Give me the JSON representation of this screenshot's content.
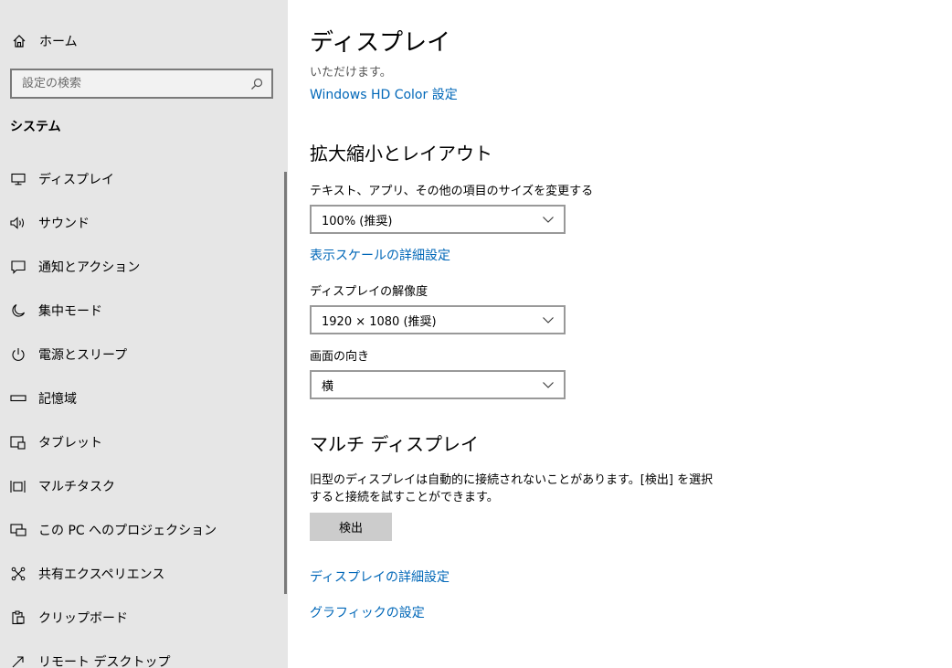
{
  "sidebar": {
    "home_label": "ホーム",
    "search_placeholder": "設定の検索",
    "section_label": "システム",
    "items": [
      {
        "label": "ディスプレイ",
        "icon": "monitor-icon"
      },
      {
        "label": "サウンド",
        "icon": "speaker-icon"
      },
      {
        "label": "通知とアクション",
        "icon": "message-icon"
      },
      {
        "label": "集中モード",
        "icon": "moon-icon"
      },
      {
        "label": "電源とスリープ",
        "icon": "power-icon"
      },
      {
        "label": "記憶域",
        "icon": "storage-icon"
      },
      {
        "label": "タブレット",
        "icon": "tablet-icon"
      },
      {
        "label": "マルチタスク",
        "icon": "multitask-icon"
      },
      {
        "label": "この PC へのプロジェクション",
        "icon": "projection-icon"
      },
      {
        "label": "共有エクスペリエンス",
        "icon": "share-icon"
      },
      {
        "label": "クリップボード",
        "icon": "clipboard-icon"
      },
      {
        "label": "リモート デスクトップ",
        "icon": "remote-icon"
      }
    ]
  },
  "main": {
    "title": "ディスプレイ",
    "cut_text": "いただけます。",
    "hd_color_link": "Windows HD Color 設定",
    "scale_layout": {
      "heading": "拡大縮小とレイアウト",
      "size_label": "テキスト、アプリ、その他の項目のサイズを変更する",
      "size_value": "100% (推奨)",
      "advanced_scale_link": "表示スケールの詳細設定",
      "resolution_label": "ディスプレイの解像度",
      "resolution_value": "1920 × 1080 (推奨)",
      "orientation_label": "画面の向き",
      "orientation_value": "横"
    },
    "multi_display": {
      "heading": "マルチ ディスプレイ",
      "description": "旧型のディスプレイは自動的に接続されないことがあります。[検出] を選択すると接続を試すことができます。",
      "detect_button": "検出",
      "advanced_display_link": "ディスプレイの詳細設定",
      "graphics_link": "グラフィックの設定"
    }
  }
}
